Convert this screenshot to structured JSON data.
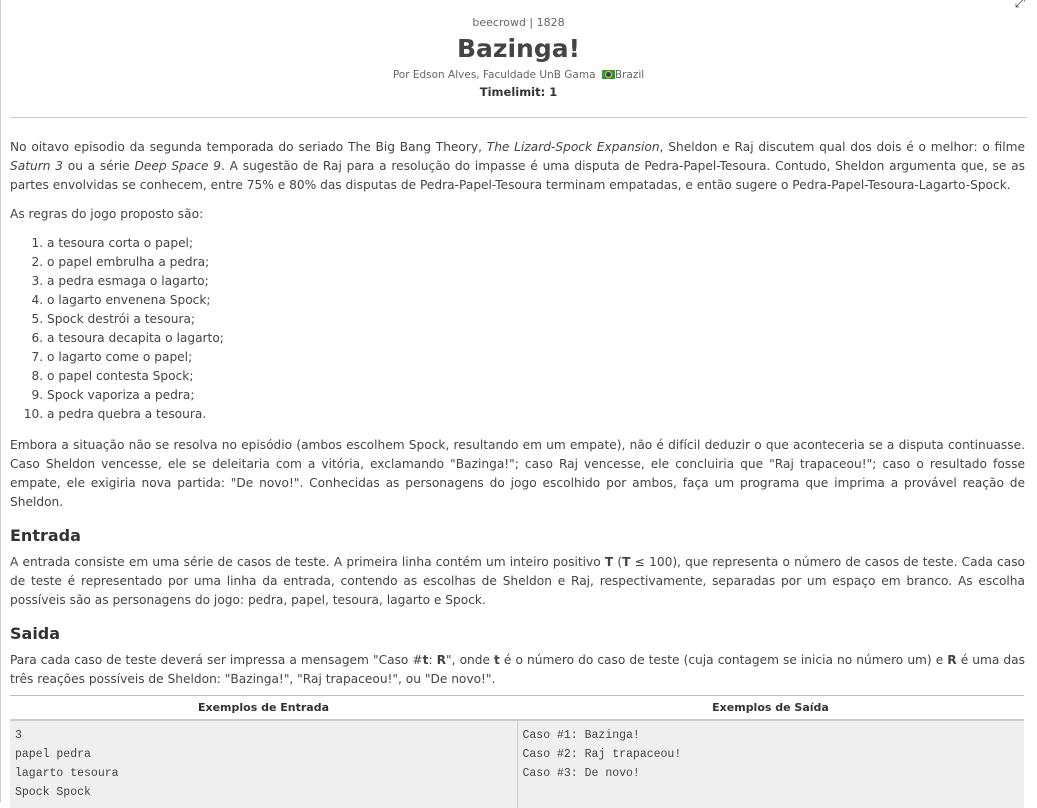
{
  "header": {
    "origin": "beecrowd | 1828",
    "title": "Bazinga!",
    "author": "Por Edson Alves, Faculdade UnB Gama",
    "country": "Brazil",
    "timelimit": "Timelimit: 1"
  },
  "description": {
    "p1": [
      "No oitavo episodio da segunda temporada do seriado The Big Bang Theory, ",
      "The Lizard-Spock Expansion",
      ", Sheldon e Raj discutem qual dos dois é o melhor: o filme ",
      "Saturn 3",
      " ou a série ",
      "Deep Space 9",
      ". A sugestão de Raj para a resolução do impasse é uma disputa de Pedra-Papel-Tesoura. Contudo, Sheldon argumenta que, se as partes envolvidas se conhecem, entre 75% e 80% das disputas de Pedra-Papel-Tesoura terminam empatadas, e então sugere o Pedra-Papel-Tesoura-Lagarto-Spock."
    ],
    "p2": "As regras do jogo proposto são:",
    "rules": [
      "a tesoura corta o papel;",
      "o papel embrulha a pedra;",
      "a pedra esmaga o lagarto;",
      "o lagarto envenena Spock;",
      "Spock destrói a tesoura;",
      "a tesoura decapita o lagarto;",
      "o lagarto come o papel;",
      "o papel contesta Spock;",
      "Spock vaporiza a pedra;",
      "a pedra quebra a tesoura."
    ],
    "p3": "Embora a situação não se resolva no episódio (ambos escolhem Spock, resultando em um empate), não é difícil deduzir o que aconteceria se a disputa continuasse. Caso Sheldon vencesse, ele se deleitaria com a vitória, exclamando \"Bazinga!\"; caso Raj vencesse, ele concluiria que \"Raj trapaceou!\"; caso o resultado fosse empate, ele exigiria nova partida: \"De novo!\". Conhecidas as personagens do jogo escolhido por ambos, faça um programa que imprima a provável reação de Sheldon."
  },
  "input": {
    "heading": "Entrada",
    "text": [
      "A entrada consiste em uma série de casos de teste. A primeira linha contém um inteiro positivo ",
      "T",
      " (",
      "T",
      " ≤ 100), que representa o número de casos de teste. Cada caso de teste é representado por uma linha da entrada, contendo as escolhas de Sheldon e Raj, respectivamente, separadas por um espaço em branco. As escolha possíveis são as personagens do jogo: pedra, papel, tesoura, lagarto e Spock."
    ]
  },
  "output": {
    "heading": "Saida",
    "text": [
      "Para cada caso de teste deverá ser impressa a mensagem \"Caso #",
      "t",
      ": ",
      "R",
      "\", onde ",
      "t",
      " é o número do caso de teste (cuja contagem se inicia no número um) e ",
      "R",
      " é uma das três reações possíveis de Sheldon: \"Bazinga!\", \"Raj trapaceou!\", ou \"De novo!\"."
    ]
  },
  "samples": {
    "input_header": "Exemplos de Entrada",
    "output_header": "Exemplos de Saída",
    "input_lines": [
      "3",
      "papel pedra",
      "lagarto tesoura",
      "Spock Spock"
    ],
    "output_lines": [
      "Caso #1: Bazinga!",
      "Caso #2: Raj trapaceou!",
      "Caso #3: De novo!"
    ]
  }
}
